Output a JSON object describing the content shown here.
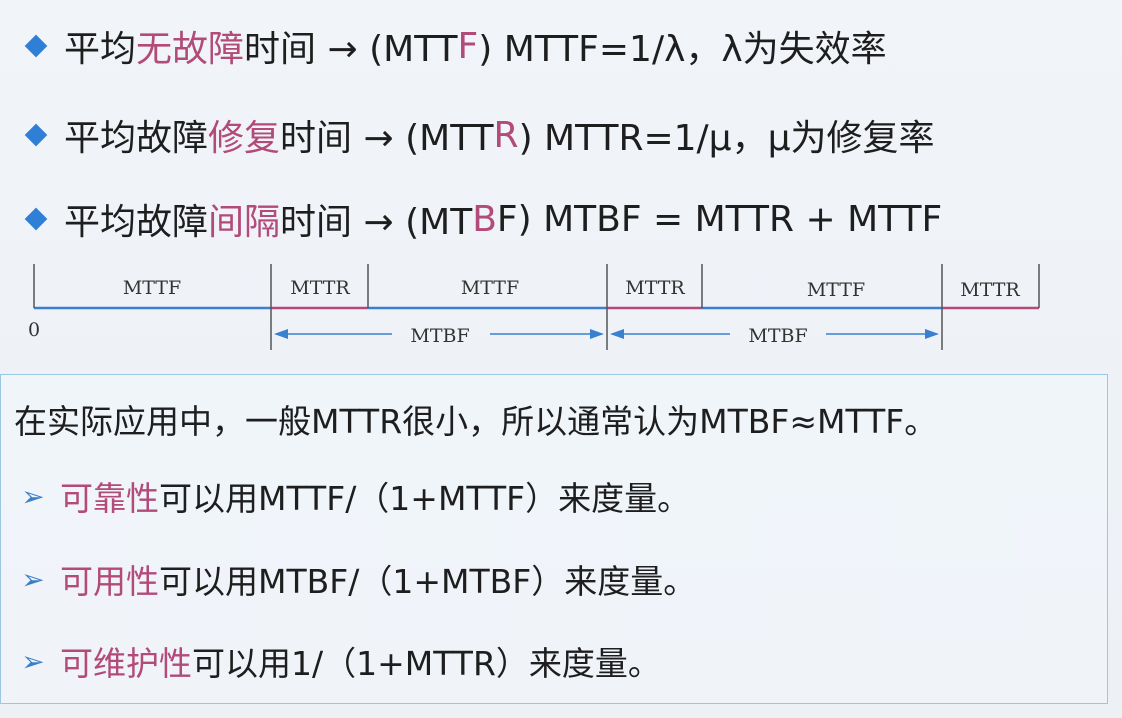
{
  "bullets": [
    {
      "segments": [
        {
          "text": "平均",
          "highlight": false
        },
        {
          "text": "无故障",
          "highlight": true
        },
        {
          "text": "时间 → (MTT",
          "highlight": false
        },
        {
          "text": "F",
          "highlight": true
        },
        {
          "text": ") MTTF=1/λ，λ为失效率",
          "highlight": false
        }
      ]
    },
    {
      "segments": [
        {
          "text": "平均故障",
          "highlight": false
        },
        {
          "text": "修复",
          "highlight": true
        },
        {
          "text": "时间 → (MTT",
          "highlight": false
        },
        {
          "text": "R",
          "highlight": true
        },
        {
          "text": ") MTTR=1/μ，μ为修复率",
          "highlight": false
        }
      ]
    },
    {
      "segments": [
        {
          "text": "平均故障",
          "highlight": false
        },
        {
          "text": "间隔",
          "highlight": true
        },
        {
          "text": "时间 → (MT",
          "highlight": false
        },
        {
          "text": "B",
          "highlight": true
        },
        {
          "text": "F) MTBF = MTTR + MTTF",
          "highlight": false
        }
      ]
    }
  ],
  "timeline": {
    "origin_label": "0",
    "segments": [
      {
        "label": "MTTF",
        "kind": "MTTF"
      },
      {
        "label": "MTTR",
        "kind": "MTTR"
      },
      {
        "label": "MTTF",
        "kind": "MTTF"
      },
      {
        "label": "MTTR",
        "kind": "MTTR"
      },
      {
        "label": "MTTF",
        "kind": "MTTF"
      },
      {
        "label": "MTTR",
        "kind": "MTTR"
      }
    ],
    "spans": [
      {
        "label": "MTBF"
      },
      {
        "label": "MTBF"
      }
    ],
    "colors": {
      "mttf_line": "#3a7fd0",
      "mttr_line": "#b24a7a",
      "tick": "#555555"
    }
  },
  "note": {
    "intro": "在实际应用中，一般MTTR很小，所以通常认为MTBF≈MTTF。",
    "items": [
      {
        "term": "可靠性",
        "rest": "可以用MTTF/（1+MTTF）来度量。"
      },
      {
        "term": "可用性",
        "rest": "可以用MTBF/（1+MTBF）来度量。"
      },
      {
        "term": "可维护性",
        "rest": "可以用1/（1+MTTR）来度量。"
      }
    ]
  },
  "colors": {
    "accent_text": "#b24a7a",
    "bullet": "#2f7fd6",
    "box_border": "#9cc7e3"
  }
}
